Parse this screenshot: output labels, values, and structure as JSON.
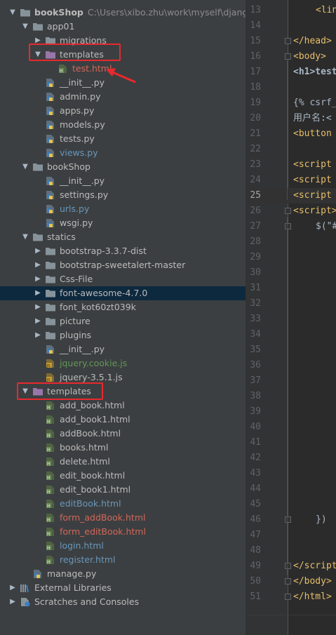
{
  "project": {
    "root": {
      "name": "bookShop",
      "path": "C:\\Users\\xibo.zhu\\work\\myself\\django_p"
    },
    "nodes": [
      {
        "label": "app01",
        "kind": "folder",
        "expanded": true,
        "color": "default"
      },
      {
        "label": "migrations",
        "kind": "folder",
        "expanded": false,
        "color": "default"
      },
      {
        "label": "templates",
        "kind": "folder-tpl",
        "expanded": true,
        "color": "default"
      },
      {
        "label": "test.html",
        "kind": "html",
        "color": "untracked"
      },
      {
        "label": "__init__.py",
        "kind": "py",
        "color": "default"
      },
      {
        "label": "admin.py",
        "kind": "py",
        "color": "default"
      },
      {
        "label": "apps.py",
        "kind": "py",
        "color": "default"
      },
      {
        "label": "models.py",
        "kind": "py",
        "color": "default"
      },
      {
        "label": "tests.py",
        "kind": "py",
        "color": "default"
      },
      {
        "label": "views.py",
        "kind": "py",
        "color": "modified"
      },
      {
        "label": "bookShop",
        "kind": "folder",
        "expanded": true,
        "color": "default"
      },
      {
        "label": "__init__.py",
        "kind": "py",
        "color": "default"
      },
      {
        "label": "settings.py",
        "kind": "py",
        "color": "default"
      },
      {
        "label": "urls.py",
        "kind": "py",
        "color": "modified"
      },
      {
        "label": "wsgi.py",
        "kind": "py",
        "color": "default"
      },
      {
        "label": "statics",
        "kind": "folder",
        "expanded": true,
        "color": "default"
      },
      {
        "label": "bootstrap-3.3.7-dist",
        "kind": "folder",
        "expanded": false,
        "color": "default"
      },
      {
        "label": "bootstrap-sweetalert-master",
        "kind": "folder",
        "expanded": false,
        "color": "default"
      },
      {
        "label": "Css-File",
        "kind": "folder",
        "expanded": false,
        "color": "default"
      },
      {
        "label": "font-awesome-4.7.0",
        "kind": "folder",
        "expanded": false,
        "color": "default",
        "selected": true
      },
      {
        "label": "font_kot60zt039k",
        "kind": "folder",
        "expanded": false,
        "color": "default"
      },
      {
        "label": "picture",
        "kind": "folder",
        "expanded": false,
        "color": "default"
      },
      {
        "label": "plugins",
        "kind": "folder",
        "expanded": false,
        "color": "default"
      },
      {
        "label": "__init__.py",
        "kind": "py",
        "color": "default"
      },
      {
        "label": "jquery.cookie.js",
        "kind": "js",
        "color": "added"
      },
      {
        "label": "jquery-3.5.1.js",
        "kind": "js",
        "color": "default"
      },
      {
        "label": "templates",
        "kind": "folder-tpl",
        "expanded": true,
        "color": "default"
      },
      {
        "label": "add_book.html",
        "kind": "html",
        "color": "default"
      },
      {
        "label": "add_book1.html",
        "kind": "html",
        "color": "default"
      },
      {
        "label": "addBook.html",
        "kind": "html",
        "color": "default"
      },
      {
        "label": "books.html",
        "kind": "html",
        "color": "default"
      },
      {
        "label": "delete.html",
        "kind": "html",
        "color": "default"
      },
      {
        "label": "edit_book.html",
        "kind": "html",
        "color": "default"
      },
      {
        "label": "edit_book1.html",
        "kind": "html",
        "color": "default"
      },
      {
        "label": "editBook.html",
        "kind": "html",
        "color": "modified"
      },
      {
        "label": "form_addBook.html",
        "kind": "html",
        "color": "untracked"
      },
      {
        "label": "form_editBook.html",
        "kind": "html",
        "color": "untracked"
      },
      {
        "label": "login.html",
        "kind": "html",
        "color": "modified"
      },
      {
        "label": "register.html",
        "kind": "html",
        "color": "modified"
      },
      {
        "label": "manage.py",
        "kind": "py",
        "color": "default"
      },
      {
        "label": "External Libraries",
        "kind": "libs",
        "expanded": false,
        "color": "default"
      },
      {
        "label": "Scratches and Consoles",
        "kind": "scratch",
        "expanded": false,
        "color": "default"
      }
    ]
  },
  "colors": {
    "default": "#bbbbbb",
    "modified": "#6897bb",
    "added": "#629755",
    "untracked": "#d1675a",
    "highlight": "#e8292e",
    "selection": "#0d293e"
  },
  "editor": {
    "current_line": "25",
    "lines": [
      {
        "num": "13",
        "text": "<lin"
      },
      {
        "num": "14",
        "text": ""
      },
      {
        "num": "15",
        "text": "</head>"
      },
      {
        "num": "16",
        "text": "<body>"
      },
      {
        "num": "17",
        "text": "<h1>test"
      },
      {
        "num": "18",
        "text": ""
      },
      {
        "num": "19",
        "text": "{% csrf_"
      },
      {
        "num": "20",
        "text": "用户名:<"
      },
      {
        "num": "21",
        "text": "<button"
      },
      {
        "num": "22",
        "text": ""
      },
      {
        "num": "23",
        "text": "<script"
      },
      {
        "num": "24",
        "text": "<script"
      },
      {
        "num": "25",
        "text": "<script"
      },
      {
        "num": "26",
        "text": "<script>"
      },
      {
        "num": "27",
        "text": "$(\"#"
      },
      {
        "num": "28",
        "text": ""
      },
      {
        "num": "29",
        "text": ""
      },
      {
        "num": "30",
        "text": ""
      },
      {
        "num": "31",
        "text": ""
      },
      {
        "num": "32",
        "text": ""
      },
      {
        "num": "33",
        "text": ""
      },
      {
        "num": "34",
        "text": ""
      },
      {
        "num": "35",
        "text": ""
      },
      {
        "num": "36",
        "text": ""
      },
      {
        "num": "37",
        "text": ""
      },
      {
        "num": "38",
        "text": ""
      },
      {
        "num": "39",
        "text": ""
      },
      {
        "num": "40",
        "text": ""
      },
      {
        "num": "41",
        "text": ""
      },
      {
        "num": "42",
        "text": ""
      },
      {
        "num": "43",
        "text": ""
      },
      {
        "num": "44",
        "text": ""
      },
      {
        "num": "45",
        "text": ""
      },
      {
        "num": "46",
        "text": "})"
      },
      {
        "num": "47",
        "text": ""
      },
      {
        "num": "48",
        "text": ""
      },
      {
        "num": "49",
        "text": "</script"
      },
      {
        "num": "50",
        "text": "</body>"
      },
      {
        "num": "51",
        "text": "</html>"
      }
    ]
  }
}
